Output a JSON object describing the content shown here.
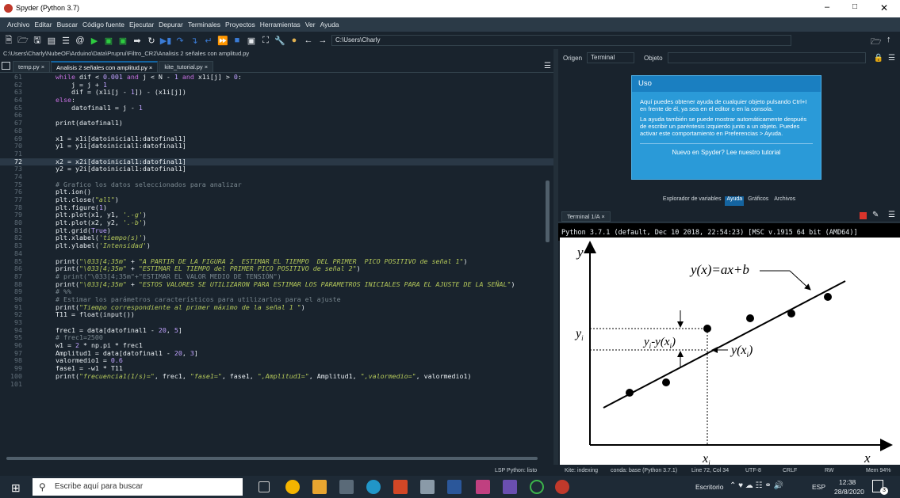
{
  "app": {
    "title": "Spyder (Python 3.7)"
  },
  "menu": [
    "Archivo",
    "Editar",
    "Buscar",
    "Código fuente",
    "Ejecutar",
    "Depurar",
    "Terminales",
    "Proyectos",
    "Herramientas",
    "Ver",
    "Ayuda"
  ],
  "toolbar": {
    "cwd": "C:\\Users\\Charly"
  },
  "editor": {
    "path": "C:\\Users\\Charly\\NubeOF\\Arduino\\Data\\Pruprui\\Filtro_CR2\\Analisis 2 señales con amplitud.py",
    "tabs": [
      "temp.py",
      "Analisis 2 señales con amplitud.py",
      "kite_tutorial.py"
    ],
    "lines": [
      {
        "n": "61",
        "c": "    while dif < 0.001 and j < N - 1 and x1i[j] > 0:"
      },
      {
        "n": "62",
        "c": "        j = j + 1"
      },
      {
        "n": "63",
        "c": "        dif = (x1i[j - 1]) - (x1i[j])"
      },
      {
        "n": "64",
        "c": "    else:"
      },
      {
        "n": "65",
        "c": "        datofinal1 = j - 1"
      },
      {
        "n": "66",
        "c": ""
      },
      {
        "n": "67",
        "c": "    print(datofinal1)"
      },
      {
        "n": "68",
        "c": ""
      },
      {
        "n": "69",
        "c": "    x1 = x1i[datoinicial1:datofinal1]"
      },
      {
        "n": "70",
        "c": "    y1 = y1i[datoinicial1:datofinal1]"
      },
      {
        "n": "71",
        "c": ""
      },
      {
        "n": "72",
        "c": "    x2 = x2i[datoinicial1:datofinal1]"
      },
      {
        "n": "73",
        "c": "    y2 = y2i[datoinicial1:datofinal1]"
      },
      {
        "n": "74",
        "c": ""
      },
      {
        "n": "75",
        "c": "    # Grafico los datos seleccionados para analizar"
      },
      {
        "n": "76",
        "c": "    plt.ion()"
      },
      {
        "n": "77",
        "c": "    plt.close(\"all\")"
      },
      {
        "n": "78",
        "c": "    plt.figure(1)"
      },
      {
        "n": "79",
        "c": "    plt.plot(x1, y1, '.-g')"
      },
      {
        "n": "80",
        "c": "    plt.plot(x2, y2, '.-b')"
      },
      {
        "n": "81",
        "c": "    plt.grid(True)"
      },
      {
        "n": "82",
        "c": "    plt.xlabel('tiempo(s)')"
      },
      {
        "n": "83",
        "c": "    plt.ylabel('Intensidad')"
      },
      {
        "n": "84",
        "c": ""
      },
      {
        "n": "85",
        "c": "    print(\"\\033[4;35m\" + \"A PARTIR DE LA FIGURA 2  ESTIMAR EL TIEMPO  DEL PRIMER  PICO POSITIVO de señal 1\")"
      },
      {
        "n": "86",
        "c": "    print(\"\\033[4;35m\" + \"ESTIMAR EL TIEMPO del PRIMER PICO POSITIVO de señal 2\")"
      },
      {
        "n": "87",
        "c": "    # print(\"\\033[4;35m\"+\"ESTIMAR EL VALOR MEDIO DE TENSIÓN\")"
      },
      {
        "n": "88",
        "c": "    print(\"\\033[4;35m\" + \"ESTOS VALORES SE UTILIZARON PARA ESTIMAR LOS PARAMETROS INICIALES PARA EL AJUSTE DE LA SEÑAL\")"
      },
      {
        "n": "89",
        "c": "    # %%"
      },
      {
        "n": "90",
        "c": "    # Estimar los parámetros característicos para utilizarlos para el ajuste"
      },
      {
        "n": "91",
        "c": "    print(\"Tiempo correspondiente al primer máximo de la señal 1 \")"
      },
      {
        "n": "92",
        "c": "    T11 = float(input())"
      },
      {
        "n": "93",
        "c": ""
      },
      {
        "n": "94",
        "c": "    frec1 = data[datofinal1 - 20, 5]"
      },
      {
        "n": "95",
        "c": "    # frec1=2500"
      },
      {
        "n": "96",
        "c": "    w1 = 2 * np.pi * frec1"
      },
      {
        "n": "97",
        "c": "    Amplitud1 = data[datofinal1 - 20, 3]"
      },
      {
        "n": "98",
        "c": "    valormedio1 = 0.6"
      },
      {
        "n": "99",
        "c": "    fase1 = -w1 * T11"
      },
      {
        "n": "100",
        "c": "    print(\"frecuencia1(1/s)=\", frec1, \"fase1=\", fase1, \",Amplitud1=\", Amplitud1, \",valormedio=\", valormedio1)"
      },
      {
        "n": "101",
        "c": ""
      }
    ]
  },
  "help": {
    "origin_label": "Origen",
    "origin_value": "Terminal",
    "object_label": "Objeto",
    "title": "Uso",
    "p1": "Aquí puedes obtener ayuda de cualquier objeto pulsando Ctrl+I en frente de él, ya sea en el editor o en la consola.",
    "p2": "La ayuda también se puede mostrar automáticamente después de escribir un paréntesis izquierdo junto a un objeto. Puedes activar este comportamiento en Preferencias > Ayuda.",
    "foot": "Nuevo en Spyder? Lee nuestro tutorial"
  },
  "pane_tabs": [
    "Explorador de variables",
    "Ayuda",
    "Gráficos",
    "Archivos"
  ],
  "console": {
    "tab": "Terminal 1/A",
    "banner": "Python 3.7.1 (default, Dec 10 2018, 22:54:23) [MSC v.1915 64 bit (AMD64)]"
  },
  "figure": {
    "ylab": "y",
    "xlab": "x",
    "eq": "y(x)=ax+b",
    "yi": "y",
    "yi_sub": "i",
    "diff": "y",
    "diff_sub": "i",
    "diff_rest": "-y(x",
    "diff_sub2": "i",
    "diff_end": ")",
    "yx": "y(x",
    "yx_sub": "i",
    "yx_end": ")",
    "xi": "x",
    "xi_sub": "i"
  },
  "status": {
    "lsp": "LSP Python: listo",
    "kite": "Kite: indexing",
    "conda": "conda: base (Python 3.7.1)",
    "pos": "Line 72, Col 34",
    "enc": "UTF-8",
    "eol": "CRLF",
    "rw": "RW",
    "mem": "Mem 94%"
  },
  "taskbar": {
    "search": "Escribe aquí para buscar",
    "desktop": "Escritorio",
    "lang": "ESP",
    "time": "12:38",
    "date": "28/8/2020",
    "badge": "3"
  },
  "colors": {
    "bg": "#19232d",
    "accent": "#1464a0",
    "help_box": "#2a9ad8"
  }
}
